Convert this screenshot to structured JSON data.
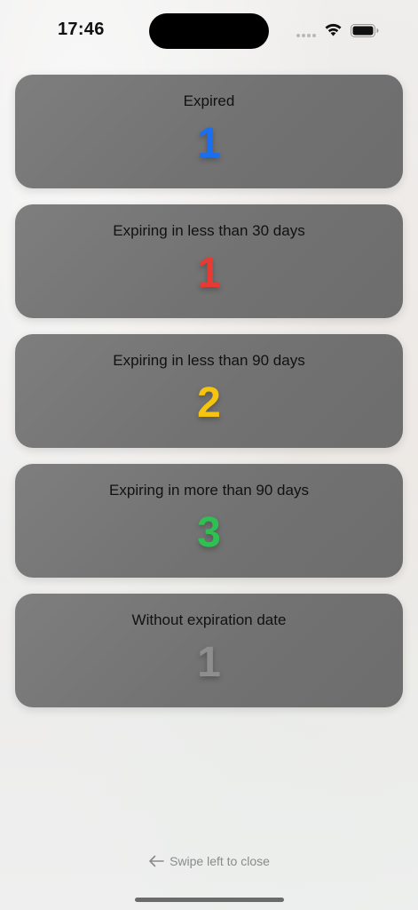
{
  "status_bar": {
    "time": "17:46"
  },
  "cards": [
    {
      "label": "Expired",
      "count": "1",
      "color": "#1a6ef0"
    },
    {
      "label": "Expiring in less than 30 days",
      "count": "1",
      "color": "#e63a32"
    },
    {
      "label": "Expiring in less than 90 days",
      "count": "2",
      "color": "#f6c40e"
    },
    {
      "label": "Expiring in more than 90 days",
      "count": "3",
      "color": "#2fc052"
    },
    {
      "label": "Without expiration date",
      "count": "1",
      "color": "#8e8e8e"
    }
  ],
  "footer": {
    "swipe_hint": "Swipe left to close",
    "hint_icon": "arrow-left-icon"
  }
}
